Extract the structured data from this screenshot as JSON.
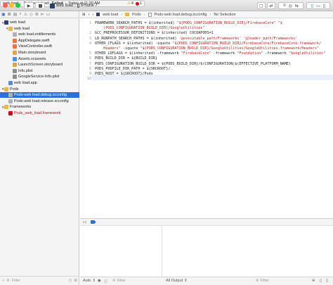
{
  "toolbar": {
    "scheme_name": "web load",
    "device": "iPhone 7",
    "status_project": "web load",
    "status_message_prefix": "Build web load:",
    "status_result": "Failed",
    "status_time": "Today at 11:30 AM",
    "warning_count": "4",
    "error_count": "1"
  },
  "navigator": {
    "items": [
      {
        "label": "web load",
        "depth": 0,
        "kind": "project",
        "disclosure": "▼"
      },
      {
        "label": "web load",
        "depth": 1,
        "kind": "folder",
        "disclosure": "▼"
      },
      {
        "label": "web load.entitlements",
        "depth": 2,
        "kind": "file"
      },
      {
        "label": "AppDelegate.swift",
        "depth": 2,
        "kind": "swift"
      },
      {
        "label": "ViewController.swift",
        "depth": 2,
        "kind": "swift"
      },
      {
        "label": "Main.storyboard",
        "depth": 2,
        "kind": "storyboard"
      },
      {
        "label": "Assets.xcassets",
        "depth": 2,
        "kind": "assets"
      },
      {
        "label": "LaunchScreen.storyboard",
        "depth": 2,
        "kind": "storyboard"
      },
      {
        "label": "Info.plist",
        "depth": 2,
        "kind": "plist"
      },
      {
        "label": "GoogleService-Info.plist",
        "depth": 2,
        "kind": "plist"
      },
      {
        "label": "web load.app",
        "depth": 1,
        "kind": "app"
      },
      {
        "label": "Pods",
        "depth": 0,
        "kind": "folder",
        "disclosure": "▼"
      },
      {
        "label": "Pods-web load.debug.xcconfig",
        "depth": 1,
        "kind": "file",
        "selected": true
      },
      {
        "label": "Pods-web load.release.xcconfig",
        "depth": 1,
        "kind": "file"
      },
      {
        "label": "Frameworks",
        "depth": 0,
        "kind": "folder",
        "disclosure": "▼"
      },
      {
        "label": "Pods_web_load.framework",
        "depth": 1,
        "kind": "framework",
        "red": true
      }
    ],
    "filter_placeholder": "Filter"
  },
  "jumpbar": {
    "crumbs": [
      "web load",
      "Pods",
      "Pods-web load.debug.xcconfig",
      "No Selection"
    ]
  },
  "editor": {
    "lines": [
      {
        "num": "1",
        "spans": [
          {
            "t": "FRAMEWORK_SEARCH_PATHS = $(inherited) ",
            "c": ""
          },
          {
            "t": "\"${PODS_CONFIGURATION_BUILD_DIR}/FirebaseCore\" \"$",
            "c": "s"
          }
        ]
      },
      {
        "num": "",
        "spans": [
          {
            "t": "    (PODS_CONFIGURATION_BUILD_DIR)/GoogleUtilities\"",
            "c": "s"
          }
        ]
      },
      {
        "num": "2",
        "spans": [
          {
            "t": "GCC_PREPROCESSOR_DEFINITIONS = $(inherited) COCOAPODS=",
            "c": ""
          },
          {
            "t": "1",
            "c": "c"
          }
        ]
      },
      {
        "num": "3",
        "spans": [
          {
            "t": "LD_RUNPATH_SEARCH_PATHS = $(inherited) ",
            "c": ""
          },
          {
            "t": "'@executable_path/Frameworks' '@loader_path/Frameworks'",
            "c": "s"
          }
        ]
      },
      {
        "num": "4",
        "spans": [
          {
            "t": "OTHER_CFLAGS = $(inherited) -iquote ",
            "c": ""
          },
          {
            "t": "\"${PODS_CONFIGURATION_BUILD_DIR}/FirebaseCore/FirebaseCore.framework/",
            "c": "s"
          }
        ]
      },
      {
        "num": "",
        "spans": [
          {
            "t": "    Headers\"",
            "c": "s"
          },
          {
            "t": " -iquote ",
            "c": ""
          },
          {
            "t": "\"${PODS_CONFIGURATION_BUILD_DIR}/GoogleUtilities/GoogleUtilities.framework/Headers\"",
            "c": "s"
          }
        ]
      },
      {
        "num": "5",
        "spans": [
          {
            "t": "OTHER_LDFLAGS = $(inherited) -framework ",
            "c": ""
          },
          {
            "t": "\"FirebaseCore\"",
            "c": "s"
          },
          {
            "t": " -framework ",
            "c": ""
          },
          {
            "t": "\"Foundation\"",
            "c": "s"
          },
          {
            "t": " -framework ",
            "c": ""
          },
          {
            "t": "\"GoogleUtilities\"",
            "c": "s"
          }
        ]
      },
      {
        "num": "6",
        "spans": [
          {
            "t": "PODS_BUILD_DIR = ${BUILD_DIR}",
            "c": ""
          }
        ]
      },
      {
        "num": "7",
        "spans": [
          {
            "t": "PODS_CONFIGURATION_BUILD_DIR = ${PODS_BUILD_DIR}/$(CONFIGURATION)$(EFFECTIVE_PLATFORM_NAME)",
            "c": ""
          }
        ]
      },
      {
        "num": "8",
        "spans": [
          {
            "t": "PODS_PODFILE_DIR_PATH = ${SRCROOT}/.",
            "c": ""
          }
        ]
      },
      {
        "num": "9",
        "spans": [
          {
            "t": "PODS_ROOT = ${SRCROOT}/Pods",
            "c": ""
          }
        ]
      },
      {
        "num": "10",
        "spans": []
      }
    ]
  },
  "bottom": {
    "auto_label": "Auto",
    "var_filter_placeholder": "Filter",
    "output_label": "All Output",
    "console_filter_placeholder": "Filter"
  },
  "colors": {
    "selection": "#2f6fd6",
    "string": "#c41a16",
    "number": "#1c00cf",
    "folder": "#e8b64a",
    "red_file": "#d0021b"
  }
}
